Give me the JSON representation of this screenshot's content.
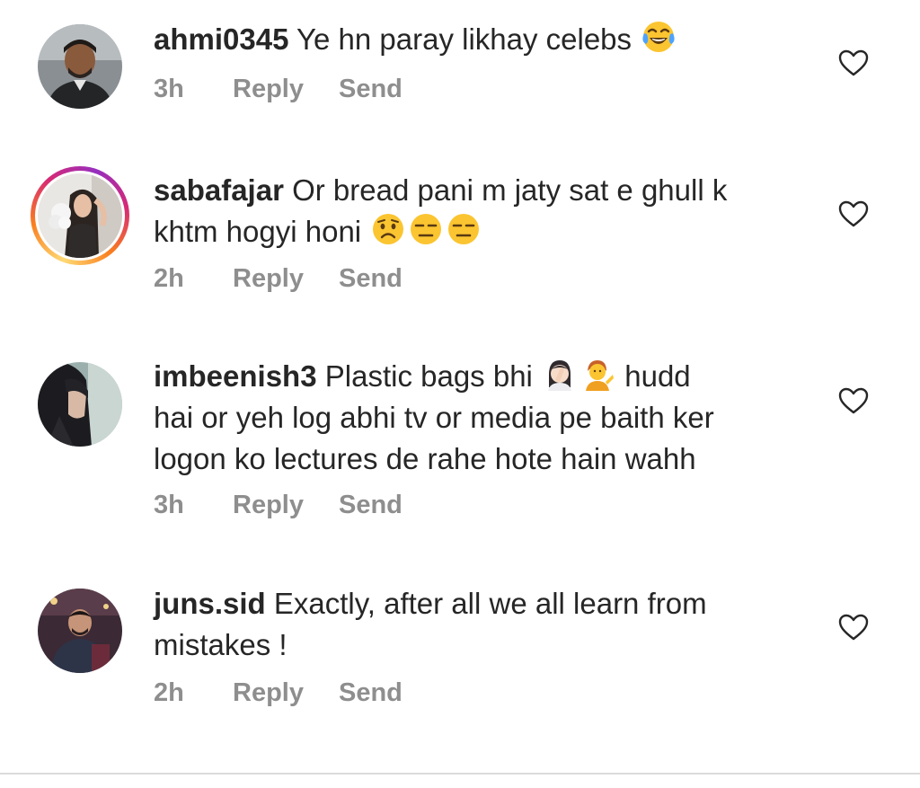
{
  "comments": [
    {
      "username": "ahmi0345",
      "text_lines": [
        "Ye hn paray likhay celebs"
      ],
      "emojis": [
        "joy"
      ],
      "time": "3h",
      "reply_label": "Reply",
      "send_label": "Send"
    },
    {
      "username": "sabafajar",
      "text_lines": [
        "Or bread pani m jaty sat e ghull k",
        "khtm hogyi honi"
      ],
      "emojis": [
        "worried",
        "expressionless",
        "expressionless"
      ],
      "time": "2h",
      "reply_label": "Reply",
      "send_label": "Send",
      "has_story_ring": true
    },
    {
      "username": "imbeenish3",
      "text_lines": [
        "Plastic bags bhi",
        "hudd",
        "hai or yeh log abhi tv or media pe baith ker",
        "logon ko lectures de rahe hote hain wahh"
      ],
      "emojis": [
        "woman-facepalming",
        "person-tipping-hand"
      ],
      "time": "3h",
      "reply_label": "Reply",
      "send_label": "Send"
    },
    {
      "username": "juns.sid",
      "text_lines": [
        "Exactly, after all we all learn from",
        "mistakes !"
      ],
      "emojis": [],
      "time": "2h",
      "reply_label": "Reply",
      "send_label": "Send"
    }
  ],
  "icons": {
    "like": "heart-outline-icon"
  },
  "colors": {
    "text": "#262626",
    "meta": "#8e8e8e",
    "divider": "#dbdbdb"
  }
}
